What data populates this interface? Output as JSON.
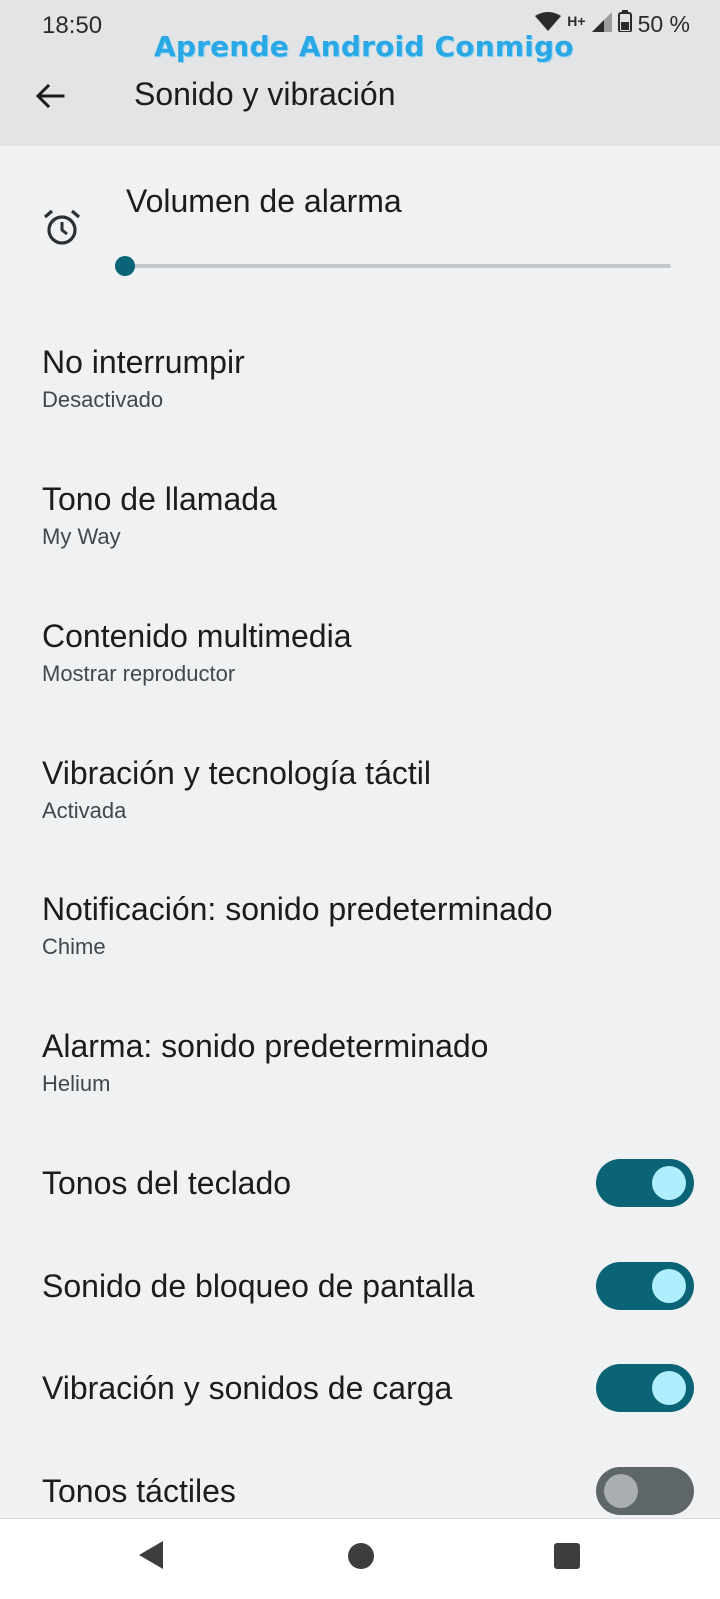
{
  "status_bar": {
    "time": "18:50",
    "network": "H+",
    "battery": "50 %",
    "icons": [
      "wifi-icon",
      "signal-icon",
      "battery-icon"
    ]
  },
  "watermark": "Aprende Android Conmigo",
  "header": {
    "title": "Sonido y vibración",
    "back_icon": "arrow-left-icon"
  },
  "alarm_volume": {
    "label": "Volumen de alarma",
    "icon": "alarm-clock-icon",
    "level": 0
  },
  "preferences": [
    {
      "title": "No interrumpir",
      "summary": "Desactivado"
    },
    {
      "title": "Tono de llamada",
      "summary": "My Way"
    },
    {
      "title": "Contenido multimedia",
      "summary": "Mostrar reproductor"
    },
    {
      "title": "Vibración y tecnología táctil",
      "summary": "Activada"
    },
    {
      "title": "Notificación: sonido predeterminado",
      "summary": "Chime"
    },
    {
      "title": "Alarma: sonido predeterminado",
      "summary": "Helium"
    }
  ],
  "toggles": [
    {
      "label": "Tonos del teclado",
      "on": true
    },
    {
      "label": "Sonido de bloqueo de pantalla",
      "on": true
    },
    {
      "label": "Vibración y sonidos de carga",
      "on": true
    },
    {
      "label": "Tonos táctiles",
      "on": false
    }
  ],
  "colors": {
    "accent": "#0b6376",
    "switch_knob_on": "#aeeefd",
    "watermark": "#2aa8e6"
  },
  "nav_bar": [
    "back-triangle-icon",
    "home-circle-icon",
    "recents-square-icon"
  ]
}
